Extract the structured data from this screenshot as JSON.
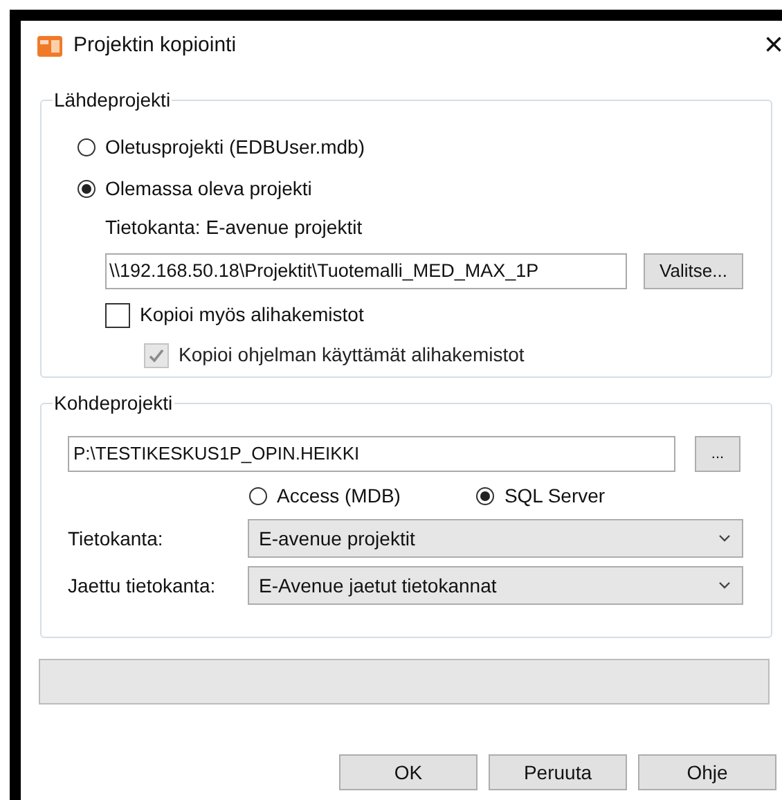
{
  "window": {
    "title": "Projektin kopiointi",
    "close": "×"
  },
  "source": {
    "legend": "Lähdeprojekti",
    "radios": [
      {
        "label": "Oletusprojekti (EDBUser.mdb)",
        "selected": false
      },
      {
        "label": "Olemassa oleva projekti",
        "selected": true
      }
    ],
    "database_label": "Tietokanta:",
    "database_value": "E-avenue projektit",
    "path": "\\\\192.168.50.18\\Projektit\\Tuotemalli_MED_MAX_1P",
    "browse": "Valitse...",
    "checkboxes": [
      {
        "label": "Kopioi myös alihakemistot",
        "checked": false,
        "disabled": false,
        "children": [
          {
            "label": "Kopioi ohjelman käyttämät alihakemistot",
            "checked": true,
            "disabled": true
          }
        ]
      }
    ]
  },
  "target": {
    "legend": "Kohdeprojekti",
    "path": "P:\\TESTIKESKUS1P_OPIN.HEIKKI",
    "browse": "...",
    "radios": [
      {
        "label": "Access (MDB)",
        "selected": false
      },
      {
        "label": "SQL Server",
        "selected": true
      }
    ],
    "selects": [
      {
        "label": "Tietokanta:",
        "value": "E-avenue projektit"
      },
      {
        "label": "Jaettu tietokanta:",
        "value": "E-Avenue jaetut tietokannat"
      }
    ]
  },
  "progress": {
    "level": 0
  },
  "buttons": [
    "OK",
    "Peruuta",
    "Ohje"
  ]
}
